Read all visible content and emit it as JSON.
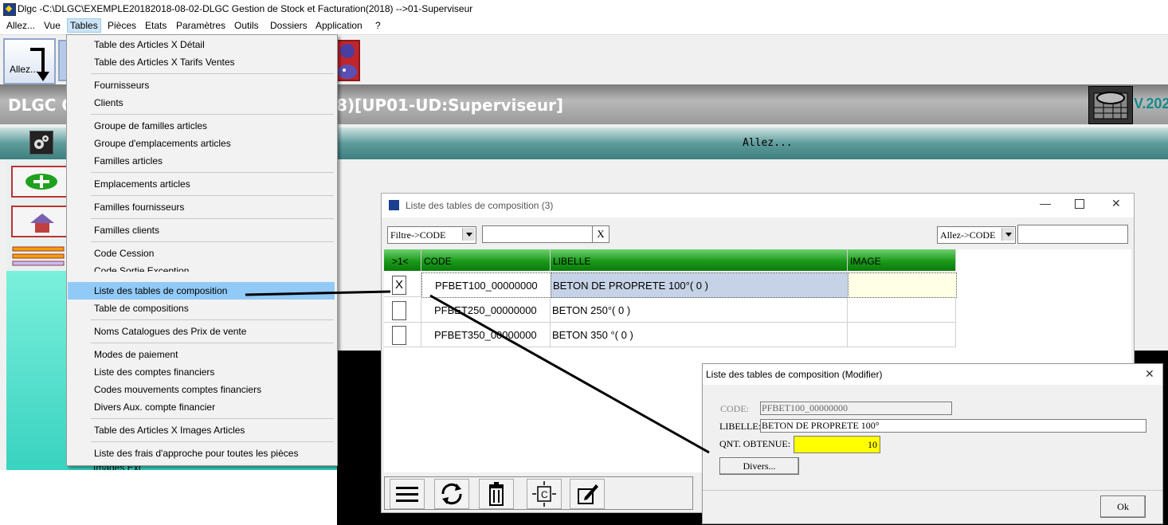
{
  "titlebar": {
    "title": "Dlgc -C:\\DLGC\\EXEMPLE20182018-08-02-DLGC Gestion de Stock et Facturation(2018) -->01-Superviseur"
  },
  "menubar": {
    "items": [
      "Allez...",
      "Vue",
      "Tables",
      "Pièces",
      "Etats",
      "Paramètres",
      "Outils",
      "Dossiers",
      "Application",
      "?"
    ]
  },
  "toolbar": {
    "allez_label": "Allez..."
  },
  "header": {
    "title_left": "DLGC G",
    "title_right": "8)[UP01-UD:Superviseur]",
    "version": "V.202"
  },
  "tealband": {
    "label": "Allez..."
  },
  "leftpanel": {
    "partial_item": "Images Ext"
  },
  "tables_menu": {
    "items": [
      "Table des Articles X Détail",
      "Table des Articles X Tarifs Ventes",
      "Fournisseurs",
      "Clients",
      "Groupe de familles articles",
      "Groupe d'emplacements articles",
      "Familles articles",
      "Emplacements articles",
      "Familles fournisseurs",
      "Familles clients",
      "Code Cession",
      "Code Sortie Exception",
      "Liste des tables de composition",
      "Table de compositions",
      "Noms Catalogues des Prix de vente",
      "Modes de paiement",
      "Liste des comptes financiers",
      "Codes mouvements comptes financiers",
      "Divers Aux. compte financier",
      "Table des Articles X Images Articles",
      "Liste des frais d'approche pour toutes les pièces"
    ],
    "highlighted": "Liste des tables de composition"
  },
  "list_window": {
    "title": "Liste des tables de composition (3)",
    "filter_select": "Filtre->CODE",
    "filter_clear": "X",
    "goto_select": "Allez->CODE",
    "columns": [
      ">1<",
      "CODE",
      "LIBELLE",
      "IMAGE"
    ],
    "rows": [
      {
        "check": "X",
        "code": "PFBET100_00000000",
        "libelle": "BETON DE PROPRETE 100°( 0 )",
        "image": ""
      },
      {
        "check": "",
        "code": "PFBET250_00000000",
        "libelle": "BETON 250°( 0 )",
        "image": ""
      },
      {
        "check": "",
        "code": "PFBET350_00000000",
        "libelle": "BETON 350 °( 0 )",
        "image": ""
      }
    ]
  },
  "modify_dialog": {
    "title": "Liste des tables de composition  (Modifier)",
    "code_label": "CODE:",
    "code_value": "PFBET100_00000000",
    "libelle_label": "LIBELLE:",
    "libelle_value": "BETON DE PROPRETE 100°",
    "qnt_label": "QNT. OBTENUE:",
    "qnt_value": "10",
    "divers_button": "Divers...",
    "ok_button": "Ok"
  },
  "colors": {
    "menu_highlight": "#91c9f7",
    "grid_header": "#1a9a1a",
    "teal": "#3f7f7f",
    "qnt_field": "#ffff00",
    "selected_row": "#c6d3e6"
  }
}
